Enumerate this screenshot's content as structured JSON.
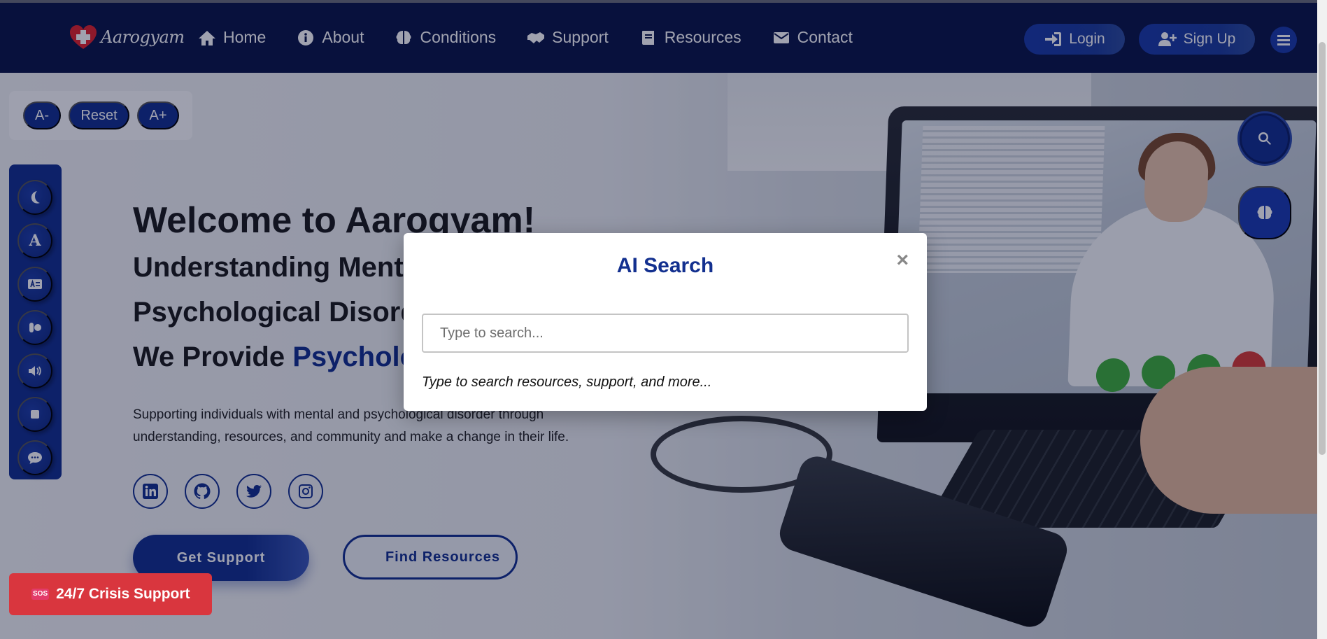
{
  "navbar": {
    "logo_text": "Aarogyam",
    "links": [
      {
        "label": "Home",
        "icon": "home-icon"
      },
      {
        "label": "About",
        "icon": "info-icon"
      },
      {
        "label": "Conditions",
        "icon": "brain-icon"
      },
      {
        "label": "Support",
        "icon": "handshake-icon"
      },
      {
        "label": "Resources",
        "icon": "book-icon"
      },
      {
        "label": "Contact",
        "icon": "envelope-icon"
      }
    ],
    "login_label": "Login",
    "signup_label": "Sign Up"
  },
  "font_controls": {
    "decrease": "A-",
    "reset": "Reset",
    "increase": "A+"
  },
  "accessibility_tools": {
    "letter_button": "A",
    "icons": [
      "moon-icon",
      "font-icon",
      "translate-icon",
      "contrast-icon",
      "speaker-icon",
      "stop-icon",
      "chat-icon"
    ]
  },
  "hero": {
    "title": "Welcome to Aarogyam!",
    "line1": "Understanding Mental",
    "line2": "Psychological Disorders",
    "line3_prefix": "We Provide ",
    "line3_accent": "Psychological",
    "description": "Supporting individuals with mental and psychological disorder through understanding, resources, and community and make a change in their life.",
    "social_icons": [
      "linkedin-icon",
      "github-icon",
      "twitter-icon",
      "instagram-icon"
    ],
    "primary_cta": "Get Support",
    "secondary_cta": "Find Resources"
  },
  "crisis": {
    "badge": "SOS",
    "label": "24/7 Crisis Support"
  },
  "modal": {
    "title": "AI Search",
    "close": "×",
    "placeholder": "Type to search...",
    "hint": "Type to search resources, support, and more..."
  },
  "colors": {
    "navbar": "#0a1548",
    "primary": "#13308f",
    "crisis": "#d9363e"
  }
}
